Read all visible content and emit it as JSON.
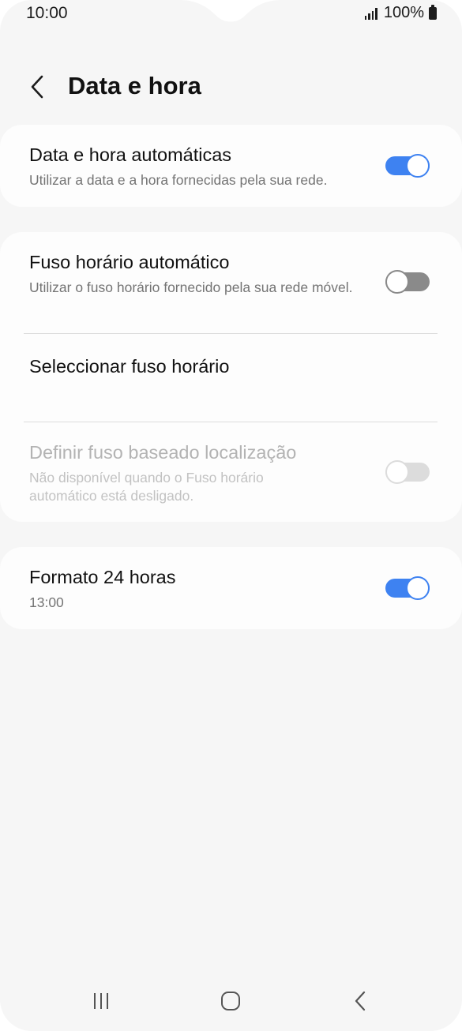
{
  "status_bar": {
    "time": "10:00",
    "battery_text": "100%",
    "icons": [
      "signal-icon",
      "battery-icon"
    ]
  },
  "header": {
    "title": "Data e hora",
    "back_icon": "chevron-left-icon"
  },
  "settings": {
    "auto_datetime": {
      "title": "Data e hora automáticas",
      "subtitle": "Utilizar a data e a hora fornecidas pela sua rede.",
      "enabled": true
    },
    "auto_timezone": {
      "title": "Fuso horário automático",
      "subtitle": "Utilizar o fuso horário fornecido pela sua rede móvel.",
      "enabled": false
    },
    "select_timezone": {
      "title": "Seleccionar fuso horário"
    },
    "location_timezone": {
      "title": "Definir fuso baseado localização",
      "subtitle": "Não disponível quando o Fuso horário automático está desligado.",
      "enabled": false,
      "disabled": true
    },
    "format_24h": {
      "title": "Formato 24 horas",
      "subtitle": "13:00",
      "enabled": true
    }
  },
  "colors": {
    "accent": "#3e82f1",
    "background": "#f6f6f6",
    "card": "#fdfdfd",
    "toggle_off": "#8a8a8a",
    "toggle_disabled": "#dcdcdc"
  },
  "nav_bar": {
    "icons": [
      "recent-apps-icon",
      "home-icon",
      "back-icon"
    ]
  }
}
